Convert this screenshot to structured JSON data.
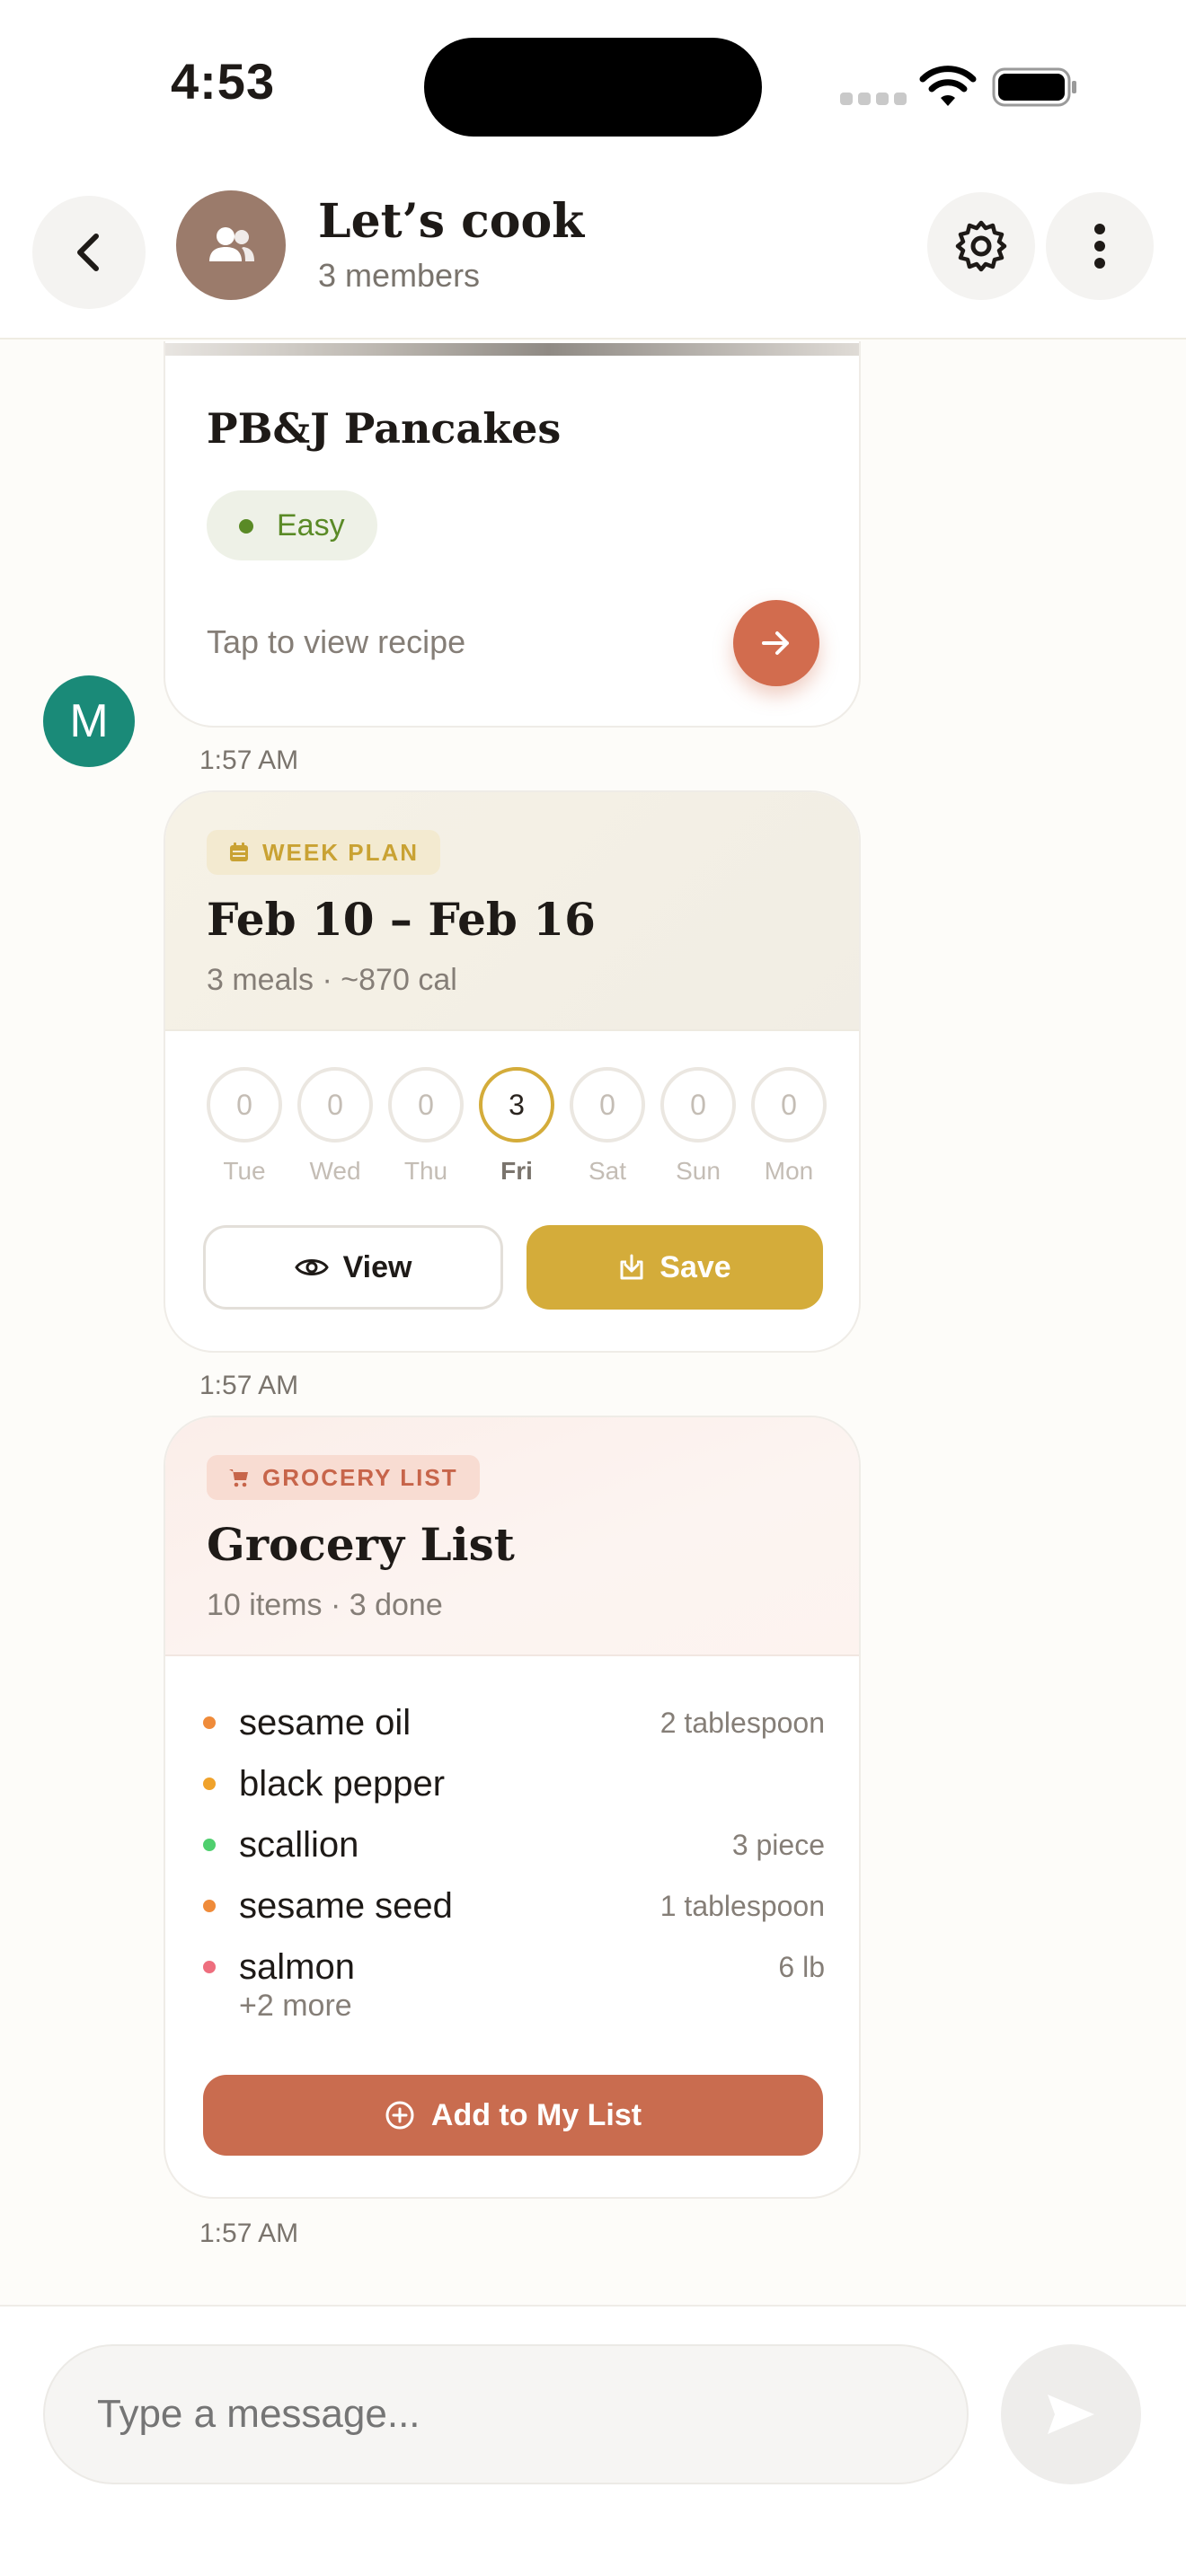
{
  "status_bar": {
    "time": "4:53"
  },
  "header": {
    "title": "Let’s cook",
    "subtitle": "3 members"
  },
  "recipe_card": {
    "name": "PB&J Pancakes",
    "difficulty": "Easy",
    "cta": "Tap to view recipe"
  },
  "sender": {
    "initial": "M"
  },
  "timestamps": [
    "1:57 AM",
    "1:57 AM",
    "1:57 AM"
  ],
  "week_plan": {
    "tag": "WEEK PLAN",
    "title": "Feb 10 – Feb 16",
    "meals": "3 meals",
    "calories": "~870 cal",
    "days": [
      {
        "label": "Tue",
        "count": "0",
        "active": false
      },
      {
        "label": "Wed",
        "count": "0",
        "active": false
      },
      {
        "label": "Thu",
        "count": "0",
        "active": false
      },
      {
        "label": "Fri",
        "count": "3",
        "active": true
      },
      {
        "label": "Sat",
        "count": "0",
        "active": false
      },
      {
        "label": "Sun",
        "count": "0",
        "active": false
      },
      {
        "label": "Mon",
        "count": "0",
        "active": false
      }
    ],
    "view_label": "View",
    "save_label": "Save"
  },
  "grocery": {
    "tag": "GROCERY LIST",
    "title": "Grocery List",
    "items_count": "10 items",
    "done_count": "3 done",
    "items": [
      {
        "name": "sesame oil",
        "qty": "2 tablespoon",
        "color": "#ef8b3a"
      },
      {
        "name": "black pepper",
        "qty": "",
        "color": "#f0a22b"
      },
      {
        "name": "scallion",
        "qty": "3 piece",
        "color": "#4fcf6e"
      },
      {
        "name": "sesame seed",
        "qty": "1 tablespoon",
        "color": "#ef8b3a"
      },
      {
        "name": "salmon",
        "qty": "6 lb",
        "color": "#ee6e7e"
      }
    ],
    "more": "+2 more",
    "add_label": "Add to My List"
  },
  "composer": {
    "placeholder": "Type a message..."
  },
  "colors": {
    "accent_gold": "#d4ac3a",
    "accent_terracotta": "#c96c4f",
    "avatar_teal": "#1a8a78",
    "group_avatar": "#9b7b6b"
  },
  "icons": {
    "back": "chevron-left-icon",
    "group": "users-icon",
    "settings": "gear-icon",
    "more": "more-vertical-icon",
    "recipe_arrow": "arrow-right-icon",
    "week_tag": "calendar-icon",
    "view": "eye-icon",
    "save": "download-icon",
    "grocery_tag": "cart-icon",
    "add": "plus-circle-icon",
    "send": "send-icon"
  }
}
